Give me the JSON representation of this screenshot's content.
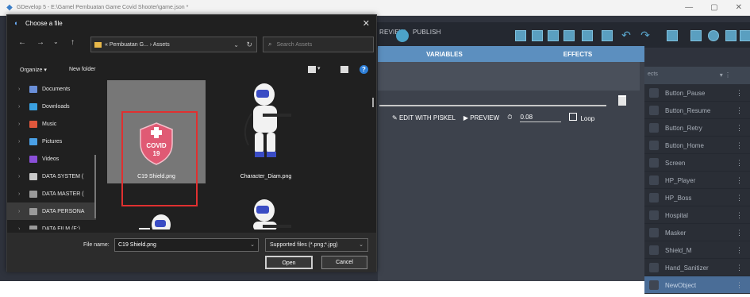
{
  "window": {
    "title": "GDevelop 5 - E:\\Gamel Pembuatan Game Covid Shooter\\game.json *",
    "controls": [
      "—",
      "▢",
      "✕"
    ]
  },
  "toolbar": {
    "preview_label": "REVIEW",
    "publish_label": "PUBLISH"
  },
  "editor": {
    "tabs": [
      "VARIABLES",
      "EFFECTS"
    ],
    "edit_with_piskel": "EDIT WITH PISKEL",
    "preview": "PREVIEW",
    "timing_value": "0.08",
    "loop_label": "Loop"
  },
  "objects_panel": {
    "header": "ects",
    "items": [
      {
        "name": "Button_Pause",
        "selected": false
      },
      {
        "name": "Button_Resume",
        "selected": false
      },
      {
        "name": "Button_Retry",
        "selected": false
      },
      {
        "name": "Button_Home",
        "selected": false
      },
      {
        "name": "Screen",
        "selected": false
      },
      {
        "name": "HP_Player",
        "selected": false
      },
      {
        "name": "HP_Boss",
        "selected": false
      },
      {
        "name": "Hospital",
        "selected": false
      },
      {
        "name": "Masker",
        "selected": false
      },
      {
        "name": "Shield_M",
        "selected": false
      },
      {
        "name": "Hand_Sanitizer",
        "selected": false
      },
      {
        "name": "NewObject",
        "selected": true
      }
    ]
  },
  "dialog": {
    "title": "Choose a file",
    "address": "« Pembuatan G... › Assets",
    "search_placeholder": "Search Assets",
    "organize": "Organize ▾",
    "new_folder": "New folder",
    "nav_items": [
      {
        "label": "Documents",
        "color": "#6a8fd8",
        "selected": false
      },
      {
        "label": "Downloads",
        "color": "#3aa0e0",
        "selected": false
      },
      {
        "label": "Music",
        "color": "#e0573c",
        "selected": false
      },
      {
        "label": "Pictures",
        "color": "#4aa0e6",
        "selected": false
      },
      {
        "label": "Videos",
        "color": "#8a4fd8",
        "selected": false
      },
      {
        "label": "DATA SYSTEM (",
        "color": "#c9c9c9",
        "selected": false
      },
      {
        "label": "DATA MASTER (",
        "color": "#9a9a9a",
        "selected": false
      },
      {
        "label": "DATA PERSONA",
        "color": "#9a9a9a",
        "selected": true
      },
      {
        "label": "DATA FILM (F:)",
        "color": "#9a9a9a",
        "selected": false
      }
    ],
    "files": [
      {
        "name": "C19 Shield.png",
        "selected": true,
        "shield_text": [
          "COVID",
          "19"
        ]
      },
      {
        "name": "Character_Diam.png",
        "selected": false
      },
      {
        "name": "",
        "selected": false
      },
      {
        "name": "",
        "selected": false
      }
    ],
    "file_name_label": "File name:",
    "file_name_value": "C19 Shield.png",
    "file_type": "Supported files (*.png;*.jpg)",
    "open_label": "Open",
    "cancel_label": "Cancel"
  },
  "colors": {
    "accent": "#5c8fbf",
    "selected_object": "#4a6d97",
    "highlight_box": "#e03030",
    "shield_fill": "#e05a74"
  }
}
